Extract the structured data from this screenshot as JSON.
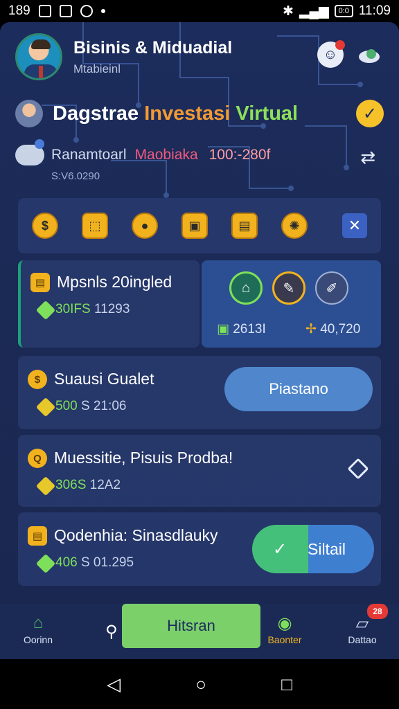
{
  "status_bar": {
    "left_time": "189",
    "clock": "11:09",
    "battery": "0:0"
  },
  "header": {
    "title": "Bisinis & Miduadial",
    "subtitle": "Mtabieinl"
  },
  "banner": {
    "title_w1": "Dagstrae",
    "title_w2": "Investasi",
    "title_w3": "Virtual",
    "label": "Ranamtoarl",
    "label2": "Maobiaka",
    "value": "100:-280f",
    "sub": "S:V6.0290"
  },
  "tools": [
    "$",
    "⬚",
    "●",
    "▣",
    "▤",
    "✺"
  ],
  "card1": {
    "title": "Mpsnls 20ingled",
    "meta_green": "30IFS",
    "meta": " 11293"
  },
  "card2": {
    "stat1": "2613I",
    "stat2": "40,720"
  },
  "card3": {
    "title": "Suausi Gualet",
    "meta_green": "500",
    "meta": " S 21:06",
    "button": "Piastano"
  },
  "card4": {
    "title": "Muessitie, Pisuis Prodba!",
    "meta_green": "306S",
    "meta": " 12A2"
  },
  "card5": {
    "title": "Qodenhia: Sinasdlauky",
    "meta_green": "406",
    "meta": " S 01.295",
    "button": "Siltail"
  },
  "bottom_nav": {
    "home": "Oorinn",
    "center": "Hitsran",
    "sheet": "Baonter",
    "map": "Dattao",
    "badge": "28"
  }
}
